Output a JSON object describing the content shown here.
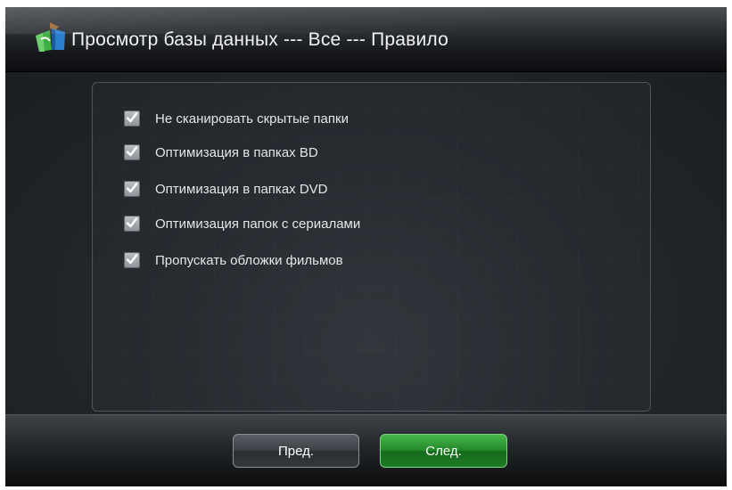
{
  "header": {
    "title": "Просмотр базы данных --- Все --- Правило",
    "icon": "media-library-icon"
  },
  "options": [
    {
      "label": "Не сканировать скрытые папки",
      "checked": true
    },
    {
      "label": "Оптимизация в папках BD",
      "checked": true
    },
    {
      "label": "Оптимизация в папках DVD",
      "checked": true
    },
    {
      "label": "Оптимизация папок с сериалами",
      "checked": true
    },
    {
      "label": "Пропускать обложки фильмов",
      "checked": true
    }
  ],
  "footer": {
    "prev_label": "Пред.",
    "next_label": "След."
  },
  "colors": {
    "accent": "#23862a",
    "background": "#1c2024",
    "text": "#e4e6e8"
  }
}
